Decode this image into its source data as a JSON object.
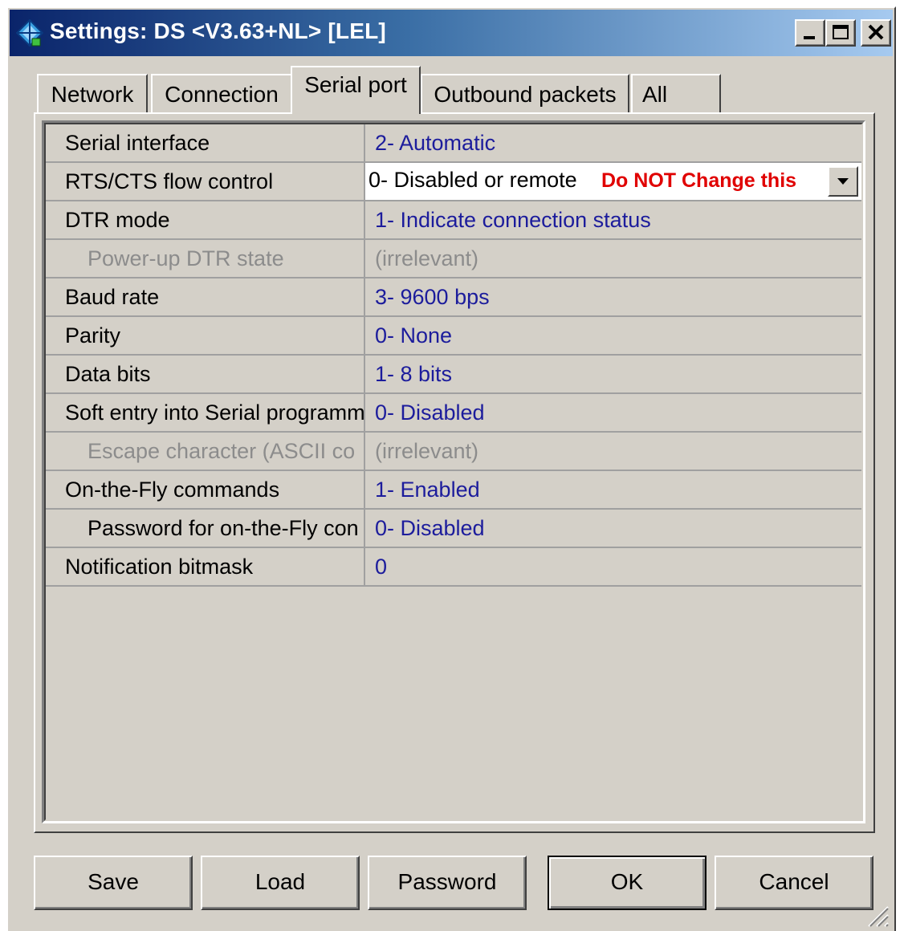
{
  "window": {
    "title": "Settings: DS <V3.63+NL> [LEL]"
  },
  "tabs": [
    {
      "label": "Network",
      "active": false
    },
    {
      "label": "Connection",
      "active": false
    },
    {
      "label": "Serial port",
      "active": true
    },
    {
      "label": "Outbound packets",
      "active": false
    },
    {
      "label": "All",
      "active": false
    }
  ],
  "settings": {
    "rows": [
      {
        "name": "Serial interface",
        "value": "2- Automatic"
      },
      {
        "name": "RTS/CTS flow control",
        "value": "0- Disabled or remote",
        "note": "Do NOT Change this"
      },
      {
        "name": "DTR mode",
        "value": "1- Indicate connection status"
      },
      {
        "name": "Power-up DTR state",
        "value": "(irrelevant)"
      },
      {
        "name": "Baud rate",
        "value": "3- 9600 bps"
      },
      {
        "name": "Parity",
        "value": "0- None"
      },
      {
        "name": "Data bits",
        "value": "1- 8 bits"
      },
      {
        "name": "Soft entry into Serial programm",
        "value": "0- Disabled"
      },
      {
        "name": "Escape character (ASCII co",
        "value": "(irrelevant)"
      },
      {
        "name": "On-the-Fly commands",
        "value": "1- Enabled"
      },
      {
        "name": "Password for on-the-Fly con",
        "value": "0- Disabled"
      },
      {
        "name": "Notification bitmask",
        "value": "0"
      }
    ]
  },
  "buttons": {
    "save": "Save",
    "load": "Load",
    "password": "Password",
    "ok": "OK",
    "cancel": "Cancel"
  },
  "icons": {
    "app": "app-icon",
    "minimize": "minimize-icon",
    "maximize": "maximize-icon",
    "close": "close-icon",
    "dropdown": "chevron-down-icon",
    "resize": "resize-grip-icon"
  },
  "colors": {
    "title_gradient_start": "#0a246a",
    "title_gradient_end": "#a6caf0",
    "value_text": "#1c1c9c",
    "disabled_text": "#8c8c8c",
    "warning_note": "#e00000",
    "face": "#d4d0c8"
  }
}
